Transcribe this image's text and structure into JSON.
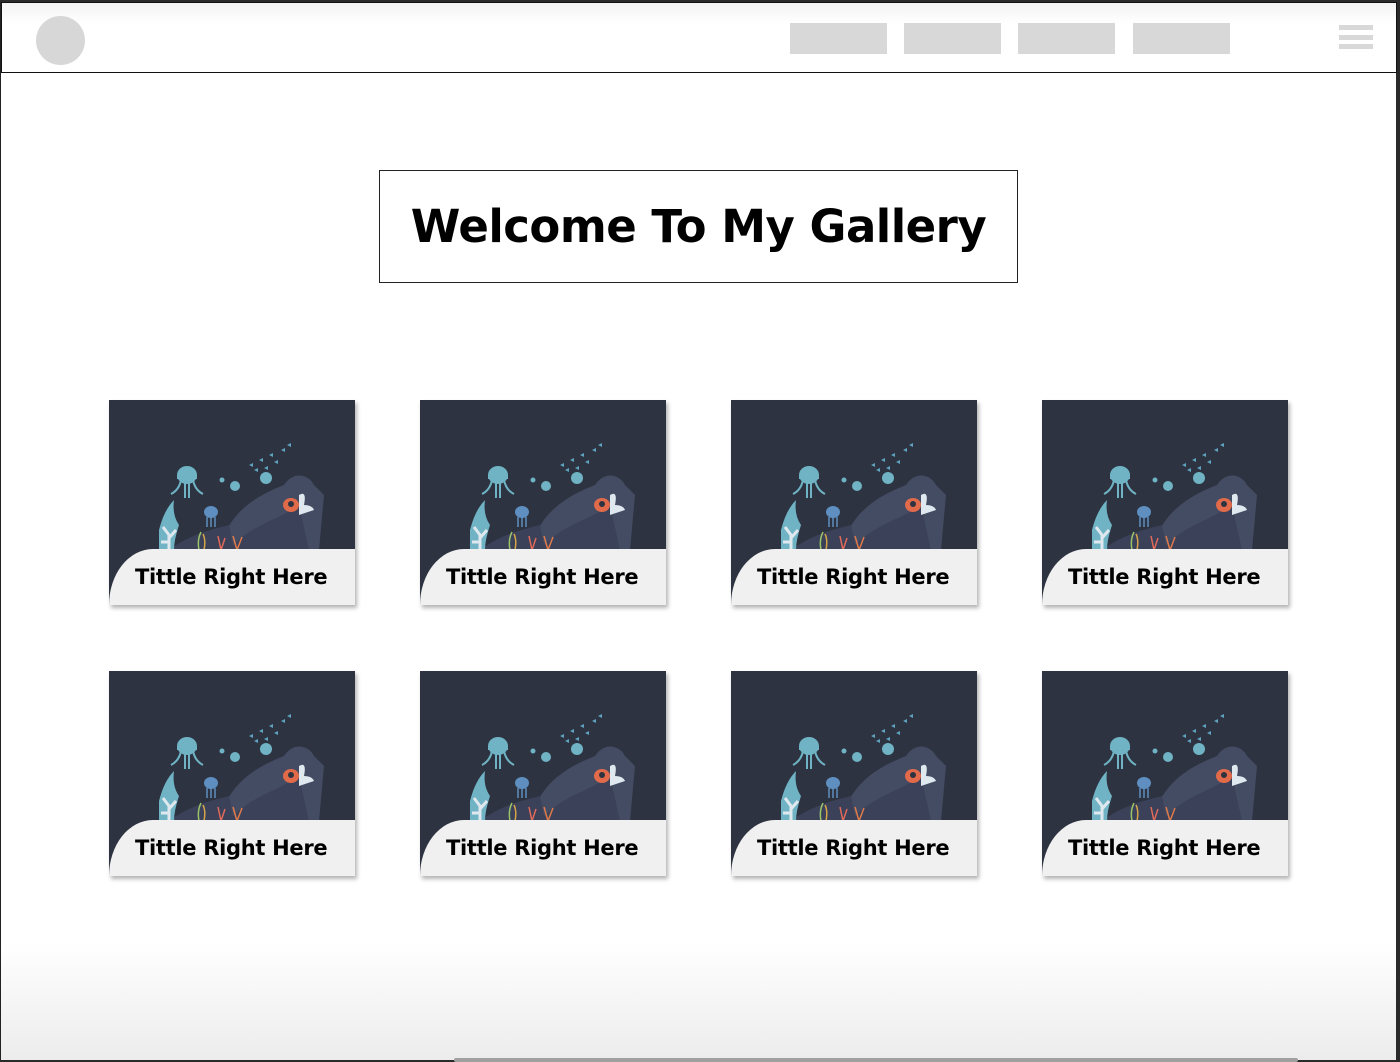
{
  "nav": {
    "buttons": [
      "",
      "",
      "",
      ""
    ]
  },
  "header": {
    "title": "Welcome To My Gallery"
  },
  "gallery": {
    "items": [
      {
        "title": "Tittle Right Here"
      },
      {
        "title": "Tittle Right Here"
      },
      {
        "title": "Tittle Right Here"
      },
      {
        "title": "Tittle Right Here"
      },
      {
        "title": "Tittle Right Here"
      },
      {
        "title": "Tittle Right Here"
      },
      {
        "title": "Tittle Right Here"
      },
      {
        "title": "Tittle Right Here"
      }
    ]
  },
  "colors": {
    "card_bg": "#2d3340",
    "caption_bg": "#f0f0f0",
    "placeholder": "#d8d8d8"
  }
}
